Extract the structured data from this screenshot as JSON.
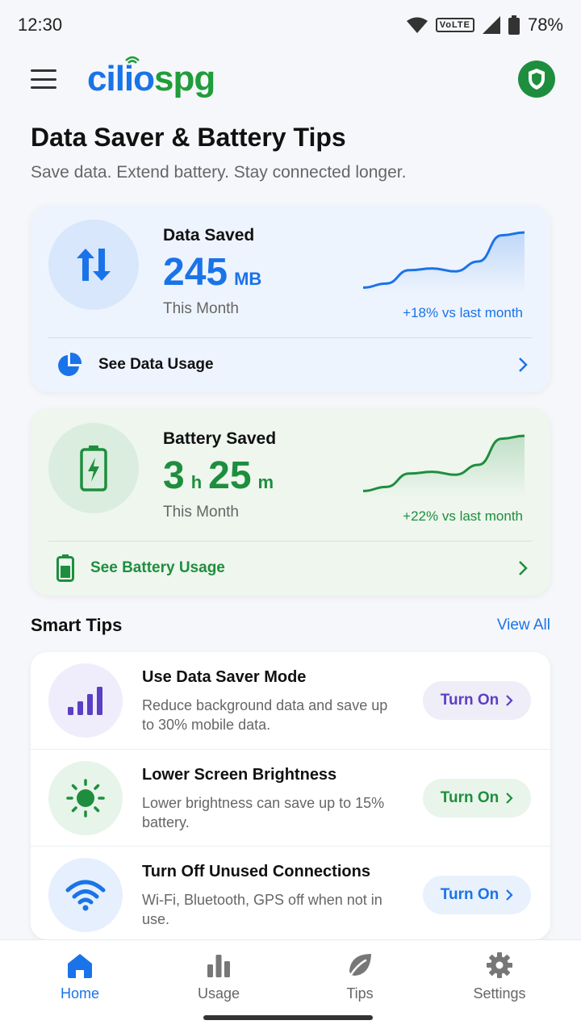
{
  "status_bar": {
    "time": "12:30",
    "network_badge": "VoLTE",
    "battery": "78%"
  },
  "app_bar": {
    "logo_part1": "cilio",
    "logo_part2": "spg",
    "menu_icon": "hamburger-menu-icon",
    "shield_icon": "shield-icon"
  },
  "header": {
    "title": "Data Saver & Battery Tips",
    "subtitle": "Save data. Extend battery. Stay connected longer."
  },
  "data_card": {
    "label": "Data Saved",
    "value": "245",
    "unit": "MB",
    "period": "This Month",
    "change": "+18% vs last month",
    "link": "See Data Usage",
    "trend": [
      0.05,
      0.12,
      0.35,
      0.38,
      0.33,
      0.5,
      0.95,
      1.0
    ],
    "color": "#1a73e8"
  },
  "battery_card": {
    "label": "Battery Saved",
    "value_hours": "3",
    "unit_hours": "h",
    "value_minutes": "25",
    "unit_minutes": "m",
    "period": "This Month",
    "change": "+22% vs last month",
    "link": "See Battery Usage",
    "trend": [
      0.05,
      0.12,
      0.35,
      0.38,
      0.33,
      0.5,
      0.95,
      1.0
    ],
    "color": "#1e8e3e"
  },
  "smart_tips": {
    "title": "Smart Tips",
    "view_all": "View All",
    "items": [
      {
        "title": "Use Data Saver Mode",
        "desc": "Reduce background data and save up to 30% mobile data.",
        "button": "Turn On",
        "icon": "signal-bars-icon"
      },
      {
        "title": "Lower Screen Brightness",
        "desc": "Lower brightness can save up to 15% battery.",
        "button": "Turn On",
        "icon": "sun-icon"
      },
      {
        "title": "Turn Off Unused Connections",
        "desc": "Wi-Fi, Bluetooth, GPS off when not in use.",
        "button": "Turn On",
        "icon": "wifi-icon"
      }
    ]
  },
  "bottom_nav": {
    "items": [
      {
        "label": "Home",
        "icon": "home-icon",
        "active": true
      },
      {
        "label": "Usage",
        "icon": "bar-chart-icon",
        "active": false
      },
      {
        "label": "Tips",
        "icon": "leaf-icon",
        "active": false
      },
      {
        "label": "Settings",
        "icon": "gear-icon",
        "active": false
      }
    ]
  }
}
